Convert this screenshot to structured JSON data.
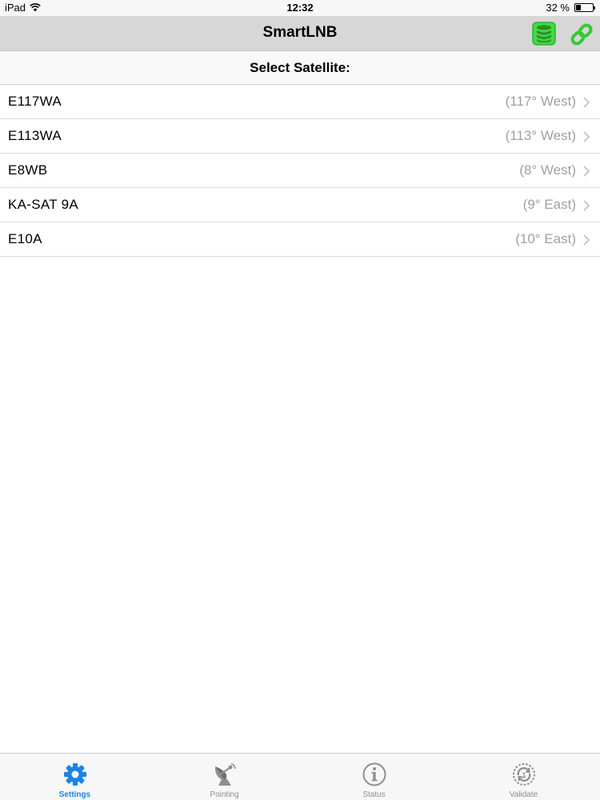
{
  "status_bar": {
    "device": "iPad",
    "time": "12:32",
    "battery": "32 %",
    "battery_level": 0.32
  },
  "nav": {
    "title": "SmartLNB",
    "database_icon": "database-icon",
    "link_icon": "link-icon",
    "icon_color": "#3bd43b"
  },
  "section": {
    "title": "Select Satellite:"
  },
  "satellites": [
    {
      "name": "E117WA",
      "position": "(117° West)"
    },
    {
      "name": "E113WA",
      "position": "(113° West)"
    },
    {
      "name": "E8WB",
      "position": "(8° West)"
    },
    {
      "name": "KA-SAT 9A",
      "position": "(9° East)"
    },
    {
      "name": "E10A",
      "position": "(10° East)"
    }
  ],
  "tabs": [
    {
      "label": "Settings",
      "icon": "gear-icon",
      "active": true
    },
    {
      "label": "Pointing",
      "icon": "satellite-dish-icon",
      "active": false
    },
    {
      "label": "Status",
      "icon": "info-icon",
      "active": false
    },
    {
      "label": "Validate",
      "icon": "validate-icon",
      "active": false
    }
  ],
  "colors": {
    "accent": "#1a83e8",
    "inactive": "#8e8e93",
    "secondary_text": "#a0a0a4",
    "nav_background": "#d7d7d7"
  }
}
